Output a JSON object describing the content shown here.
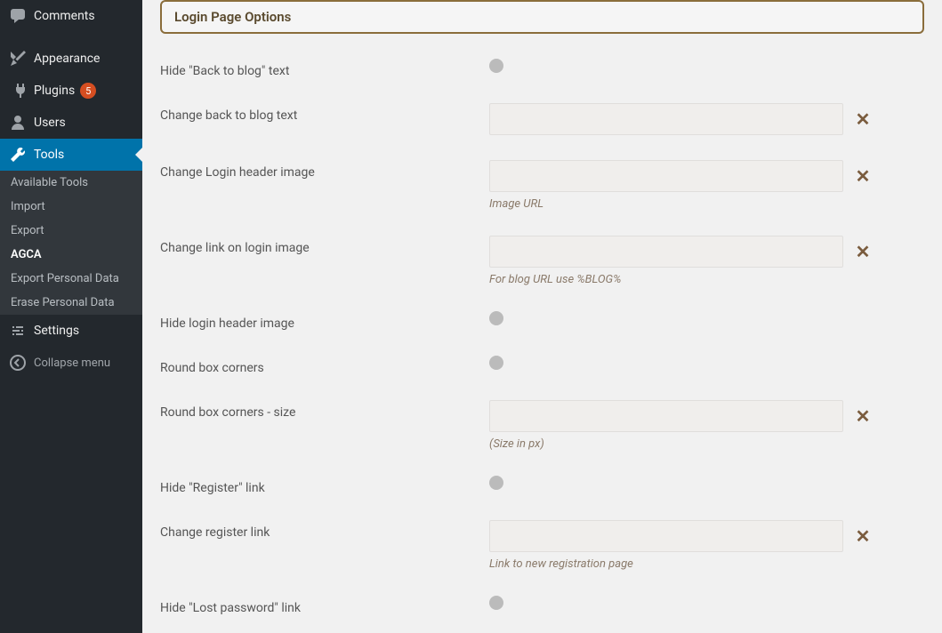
{
  "sidebar": {
    "items": [
      {
        "label": "Comments",
        "icon": "comments"
      },
      {
        "label": "Appearance",
        "icon": "appearance"
      },
      {
        "label": "Plugins",
        "icon": "plugins",
        "badge": "5"
      },
      {
        "label": "Users",
        "icon": "users"
      },
      {
        "label": "Tools",
        "icon": "tools",
        "active": true
      }
    ],
    "tools_sub": [
      {
        "label": "Available Tools"
      },
      {
        "label": "Import"
      },
      {
        "label": "Export"
      },
      {
        "label": "AGCA",
        "current": true
      },
      {
        "label": "Export Personal Data"
      },
      {
        "label": "Erase Personal Data"
      }
    ],
    "settings_label": "Settings",
    "collapse_label": "Collapse menu"
  },
  "section_title": "Login Page Options",
  "options": {
    "hide_back_to_blog": {
      "label": "Hide \"Back to blog\" text"
    },
    "change_back_to_blog": {
      "label": "Change back to blog text",
      "value": ""
    },
    "change_header_image": {
      "label": "Change Login header image",
      "value": "",
      "helper": "Image URL"
    },
    "change_link_login_image": {
      "label": "Change link on login image",
      "value": "",
      "helper": "For blog URL use %BLOG%"
    },
    "hide_login_header_image": {
      "label": "Hide login header image"
    },
    "round_box_corners": {
      "label": "Round box corners"
    },
    "round_box_corners_size": {
      "label": "Round box corners - size",
      "value": "",
      "helper": "(Size in px)"
    },
    "hide_register_link": {
      "label": "Hide \"Register\" link"
    },
    "change_register_link": {
      "label": "Change register link",
      "value": "",
      "helper": "Link to new registration page"
    },
    "hide_lost_password": {
      "label": "Hide \"Lost password\" link"
    }
  },
  "icons": {
    "close": "✕"
  }
}
